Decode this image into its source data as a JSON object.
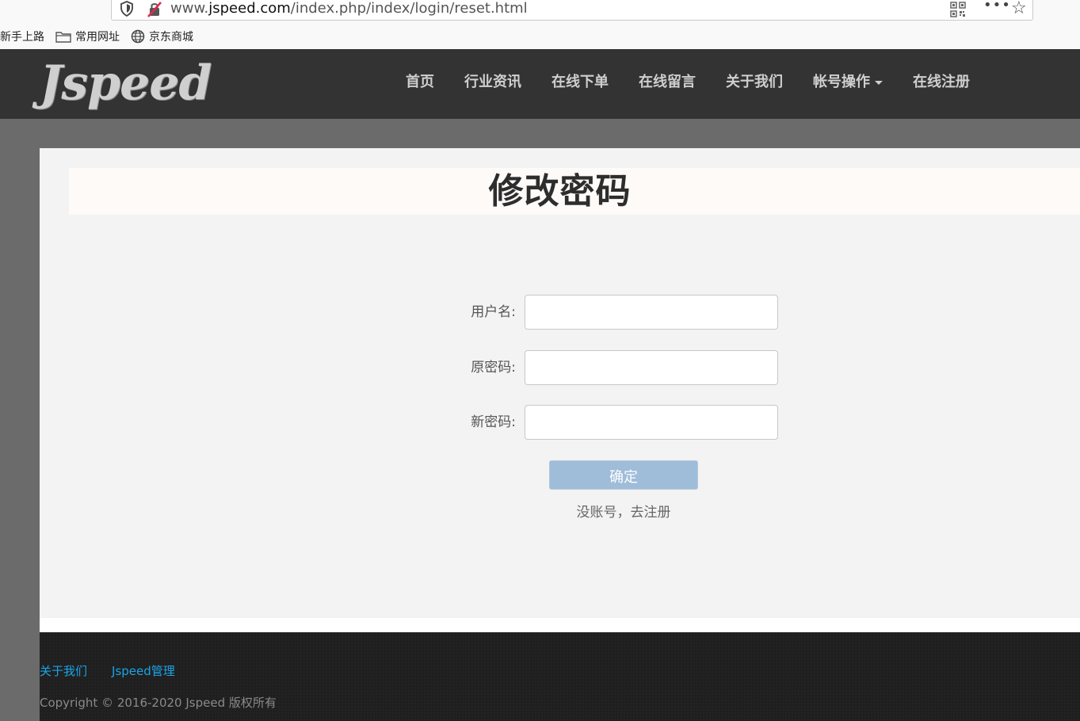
{
  "browser": {
    "url_prefix": "www.",
    "url_host": "jspeed.com",
    "url_path": "/index.php/index/login/reset.html",
    "more_glyph": "•••",
    "star_glyph": "☆",
    "icons": {
      "shield": "shield-icon",
      "lock": "insecure-lock-icon",
      "qr": "qr-code-icon",
      "more": "more-icon",
      "star": "bookmark-star-icon"
    }
  },
  "bookmarks": [
    {
      "label": "新手上路",
      "icon": ""
    },
    {
      "label": "常用网址",
      "icon": "folder-icon"
    },
    {
      "label": "京东商城",
      "icon": "globe-icon"
    }
  ],
  "site": {
    "logo": "Jspeed",
    "nav": [
      {
        "label": "首页"
      },
      {
        "label": "行业资讯"
      },
      {
        "label": "在线下单"
      },
      {
        "label": "在线留言"
      },
      {
        "label": "关于我们"
      },
      {
        "label": "帐号操作",
        "dropdown": true
      },
      {
        "label": "在线注册"
      }
    ]
  },
  "form": {
    "title": "修改密码",
    "username_label": "用户名:",
    "old_password_label": "原密码:",
    "new_password_label": "新密码:",
    "username_value": "",
    "old_password_value": "",
    "new_password_value": "",
    "submit_label": "确定",
    "register_link": "没账号，去注册",
    "button_color": "#9fbcd9"
  },
  "footer": {
    "about": "关于我们",
    "admin": "Jspeed管理",
    "copyright": "Copyright © 2016-2020 Jspeed 版权所有",
    "link_color": "#1aa4e8"
  }
}
